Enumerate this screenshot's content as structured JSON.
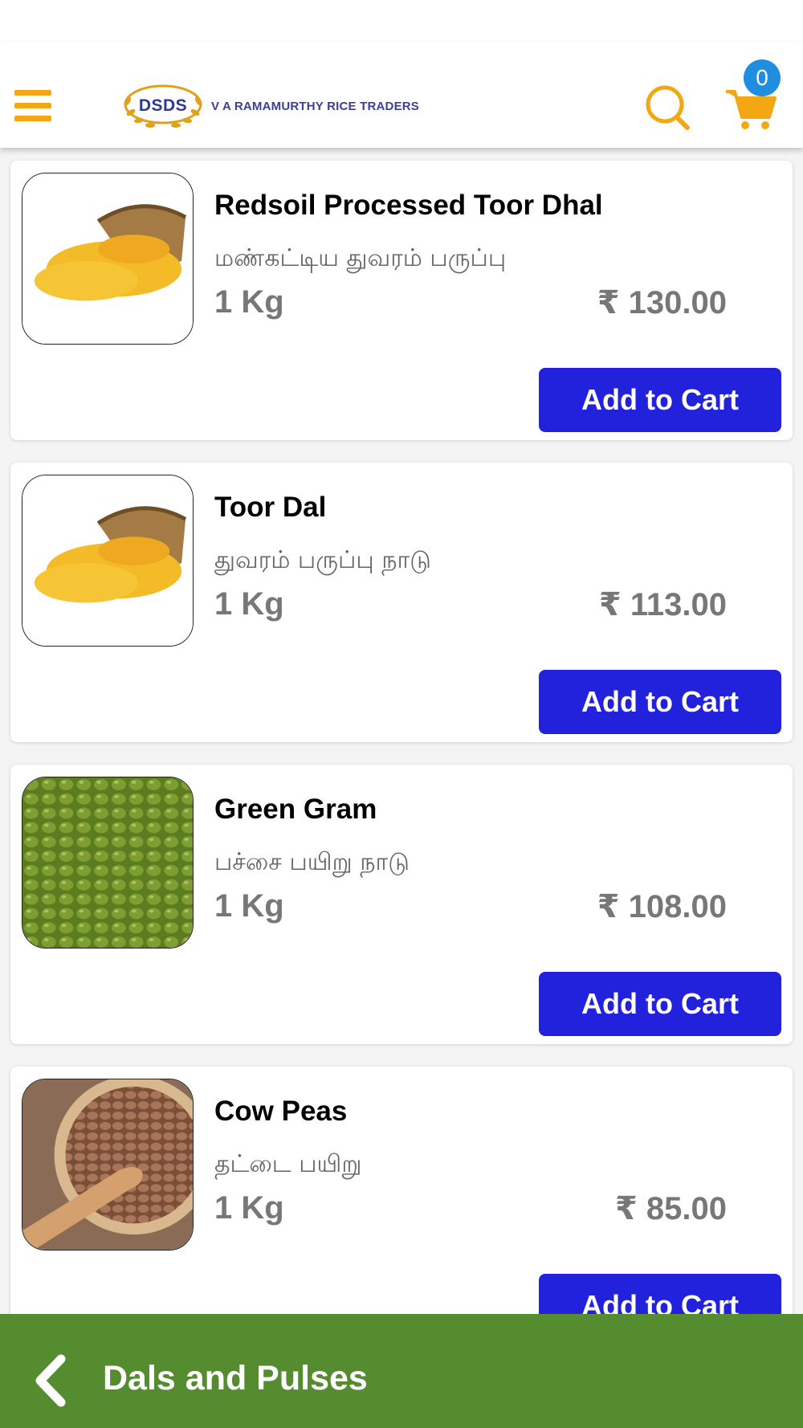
{
  "header": {
    "brand_short": "DSDS",
    "brand_name": "V A RAMAMURTHY RICE TRADERS",
    "cart_count": "0"
  },
  "colors": {
    "accent_orange": "#f3a712",
    "button_blue": "#2222dd",
    "badge_blue": "#1f8ee0",
    "footer_green": "#548c2f"
  },
  "icons": {
    "menu": "hamburger-icon",
    "search": "search-icon",
    "cart": "cart-icon",
    "back": "chevron-left-icon"
  },
  "products": [
    {
      "name": "Redsoil Processed Toor Dhal",
      "tamil": "மண்கட்டிய துவரம் பருப்பு",
      "qty": "1 Kg",
      "price": "₹ 130.00",
      "button": "Add to Cart",
      "image": "toor-dal-sack"
    },
    {
      "name": "Toor Dal",
      "tamil": "துவரம் பருப்பு நாடு",
      "qty": "1 Kg",
      "price": "₹ 113.00",
      "button": "Add to Cart",
      "image": "toor-dal-sack"
    },
    {
      "name": "Green Gram",
      "tamil": "பச்சை பயிறு நாடு",
      "qty": "1 Kg",
      "price": "₹ 108.00",
      "button": "Add to Cart",
      "image": "green-gram"
    },
    {
      "name": "Cow Peas",
      "tamil": "தட்டை பயிறு",
      "qty": "1 Kg",
      "price": "₹ 85.00",
      "button": "Add to Cart",
      "image": "cow-peas-bowl"
    }
  ],
  "footer": {
    "title": "Dals and Pulses"
  }
}
